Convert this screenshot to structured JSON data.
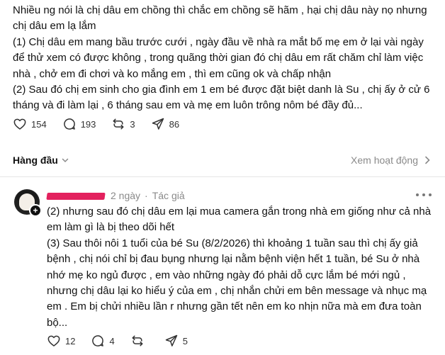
{
  "post": {
    "paragraphs": [
      "Nhiều ng nói là chị dâu em chồng thì chắc em chồng sẽ hãm , hại chị dâu này nọ nhưng chị dâu em lạ lắm",
      "(1) Chị dâu em mang bầu trước cưới , ngày đầu về nhà ra mắt bố mẹ em ở lại vài ngày để thử xem có được không , trong quãng thời gian đó chị dâu em rất chăm chỉ làm việc nhà , chở em đi chơi và ko mắng em , thì em cũng ok và chấp nhận",
      "(2) Sau đó chị em sinh cho gia đình em 1 em bé được đặt biệt danh là Su , chị ấy ở cử 6 tháng và đi làm lại , 6 tháng sau em và mẹ em luôn trông nôm bé đầy đủ..."
    ],
    "likes": "154",
    "comments": "193",
    "reposts": "3",
    "shares": "86"
  },
  "sort": {
    "label": "Hàng đầu",
    "activity_link": "Xem hoạt động"
  },
  "comment": {
    "time": "2 ngày",
    "separator": "·",
    "author_tag": "Tác giả",
    "paragraphs": [
      "(2) nhưng sau đó chị dâu em lại mua camera gắn trong nhà em giống như cả nhà em làm gì là bị theo dõi hết",
      "(3) Sau thôi nôi 1 tuổi của bé Su (8/2/2026) thì khoảng 1 tuần sau thì chị ấy giả bệnh , chị nói chỉ bị đau bụng nhưng lại nằm bệnh viện hết 1 tuần, bé Su ở nhà nhớ mẹ ko ngủ được , em vào những ngày đó phải dỗ cực lắm bé mới ngủ , nhưng chị dâu lại ko hiểu ý của em , chị nhắn chửi em bên message và nhục mạ em . Em bị chửi nhiều lần r nhưng gần tết nên em ko nhịn nữa mà em đưa toàn bộ..."
    ],
    "likes": "12",
    "comments": "4",
    "shares": "5"
  },
  "icons": {
    "like": "heart-icon",
    "comment": "speech-bubble-icon",
    "repost": "repost-icon",
    "share": "send-icon",
    "sort_chevron": "chevron-down-icon",
    "activity_chevron": "chevron-right-icon",
    "more": "more-dots-icon",
    "follow": "plus-icon"
  },
  "colors": {
    "text": "#111111",
    "muted": "#8a8a8a",
    "redaction": "#e3215e"
  }
}
